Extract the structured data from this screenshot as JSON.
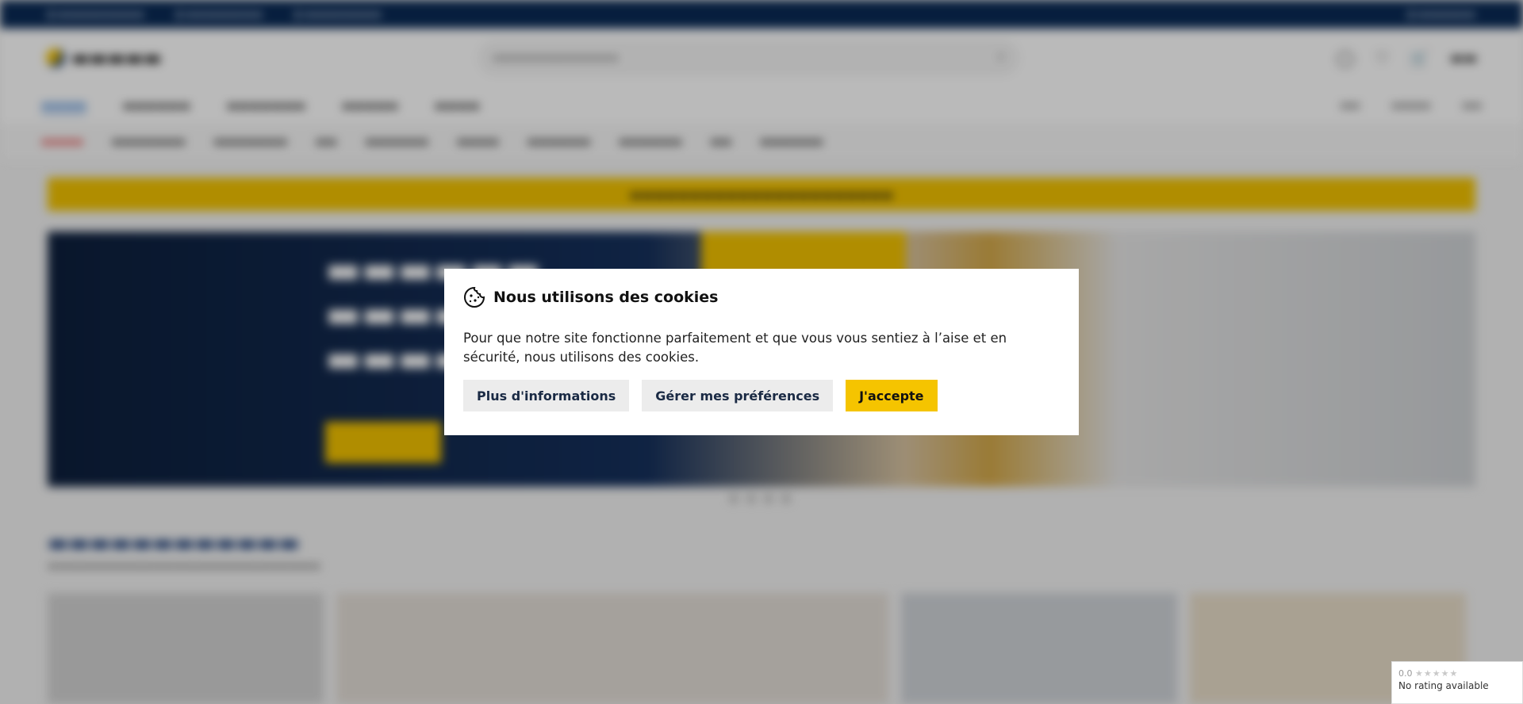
{
  "cookie_modal": {
    "title": "Nous utilisons des cookies",
    "body": "Pour que notre site fonctionne parfaitement et que vous vous sentiez à l’aise et en sécurité, nous utilisons des cookies.",
    "buttons": {
      "more_info": "Plus d'informations",
      "preferences": "Gérer mes préférences",
      "accept": "J'accepte"
    },
    "colors": {
      "accept_bg": "#f5c400",
      "secondary_bg": "#ececec"
    }
  },
  "rating_badge": {
    "score": "0.0",
    "stars": "★★★★★",
    "label": "No rating available"
  },
  "icons": [
    "cookie-icon",
    "search-icon",
    "user-icon",
    "heart-icon",
    "cart-icon"
  ],
  "colors": {
    "brand_navy": "#0a2a55",
    "brand_yellow": "#f2c200"
  }
}
